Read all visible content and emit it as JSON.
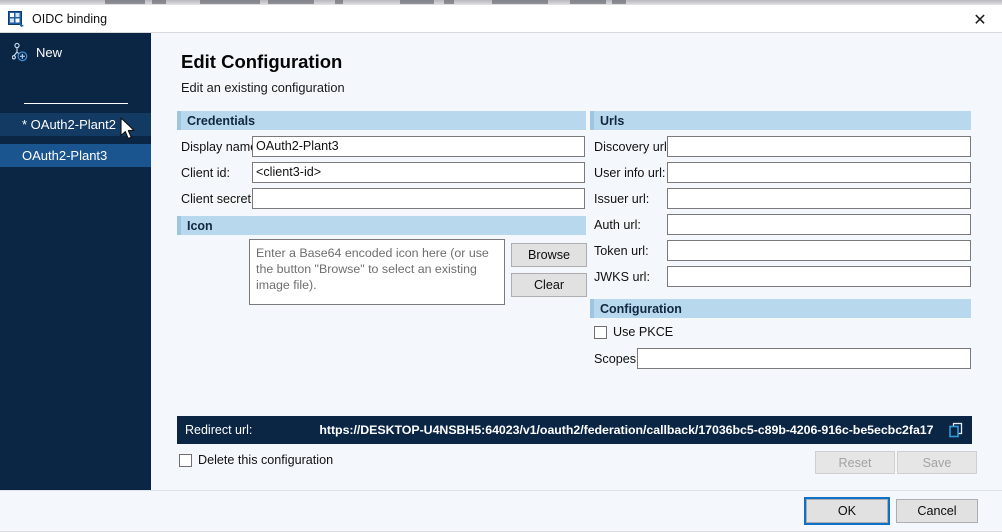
{
  "window": {
    "title": "OIDC binding",
    "icon": "oidc-binding-icon",
    "close_label": "✕"
  },
  "sidebar": {
    "new_label": "New",
    "new_icon": "new-node-icon",
    "items": [
      {
        "label": "* OAuth2-Plant2",
        "selected": false
      },
      {
        "label": "OAuth2-Plant3",
        "selected": true
      }
    ]
  },
  "main": {
    "title": "Edit Configuration",
    "subtitle": "Edit an existing configuration"
  },
  "credentials": {
    "header": "Credentials",
    "fields": [
      {
        "label": "Display name:",
        "value": "OAuth2-Plant3"
      },
      {
        "label": "Client id:",
        "value": "<client3-id>"
      },
      {
        "label": "Client secret:",
        "value": ""
      }
    ]
  },
  "icon_section": {
    "header": "Icon",
    "placeholder": "Enter a Base64 encoded icon here (or use the button \"Browse\" to select an existing image file).",
    "browse_label": "Browse",
    "clear_label": "Clear"
  },
  "urls": {
    "header": "Urls",
    "fields": [
      {
        "label": "Discovery url:",
        "value": ""
      },
      {
        "label": "User info url:",
        "value": ""
      },
      {
        "label": "Issuer url:",
        "value": ""
      },
      {
        "label": "Auth url:",
        "value": ""
      },
      {
        "label": "Token url:",
        "value": ""
      },
      {
        "label": "JWKS url:",
        "value": ""
      }
    ]
  },
  "configuration": {
    "header": "Configuration",
    "use_pkce_label": "Use PKCE",
    "use_pkce_checked": false,
    "scopes_label": "Scopes:",
    "scopes_value": ""
  },
  "redirect": {
    "label": "Redirect url:",
    "value": "https://DESKTOP-U4NSBH5:64023/v1/oauth2/federation/callback/17036bc5-c89b-4206-916c-be5ecbc2fa17",
    "copy_icon": "copy-icon"
  },
  "delete": {
    "label": "Delete this configuration",
    "checked": false
  },
  "actions": {
    "reset_label": "Reset",
    "reset_enabled": false,
    "save_label": "Save",
    "save_enabled": false,
    "ok_label": "OK",
    "cancel_label": "Cancel"
  },
  "colors": {
    "sidebar_bg": "#0b2545",
    "sidebar_selected": "#1a5590",
    "sidebar_item": "#123a63",
    "section_header_bg": "#b8d8ee",
    "panel_bg": "#f4f7fb",
    "focus_ring": "#0f70c8",
    "accent_dark": "#0b2545"
  }
}
